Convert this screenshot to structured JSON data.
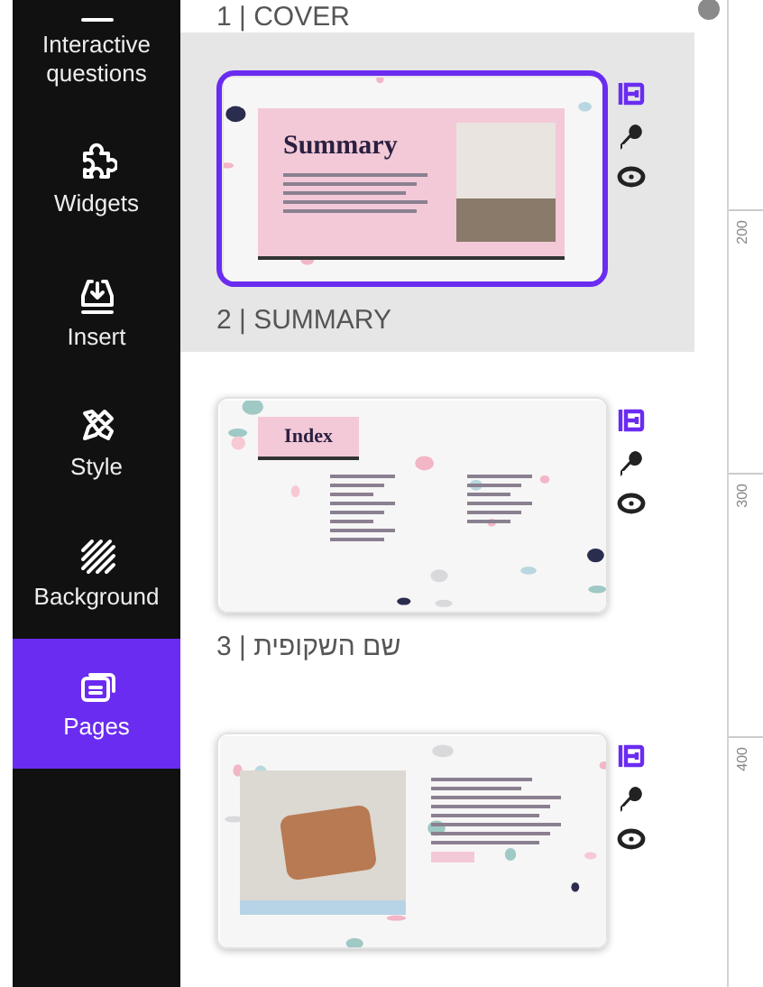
{
  "sidebar": {
    "items": [
      {
        "label": "Interactive questions",
        "selected": false
      },
      {
        "label": "Widgets",
        "selected": false
      },
      {
        "label": "Insert",
        "selected": false
      },
      {
        "label": "Style",
        "selected": false
      },
      {
        "label": "Background",
        "selected": false
      },
      {
        "label": "Pages",
        "selected": true
      }
    ]
  },
  "pages": [
    {
      "kind": "label_only",
      "label": "1 | COVER"
    },
    {
      "kind": "summary",
      "label": "2 | SUMMARY",
      "slide_title": "Summary",
      "selected": true
    },
    {
      "kind": "index",
      "label": "3 | שם השקופית",
      "slide_title": "Index",
      "selected": false
    },
    {
      "kind": "photo_text",
      "selected": false
    }
  ],
  "ruler": {
    "marks": [
      "200",
      "300",
      "400"
    ]
  }
}
